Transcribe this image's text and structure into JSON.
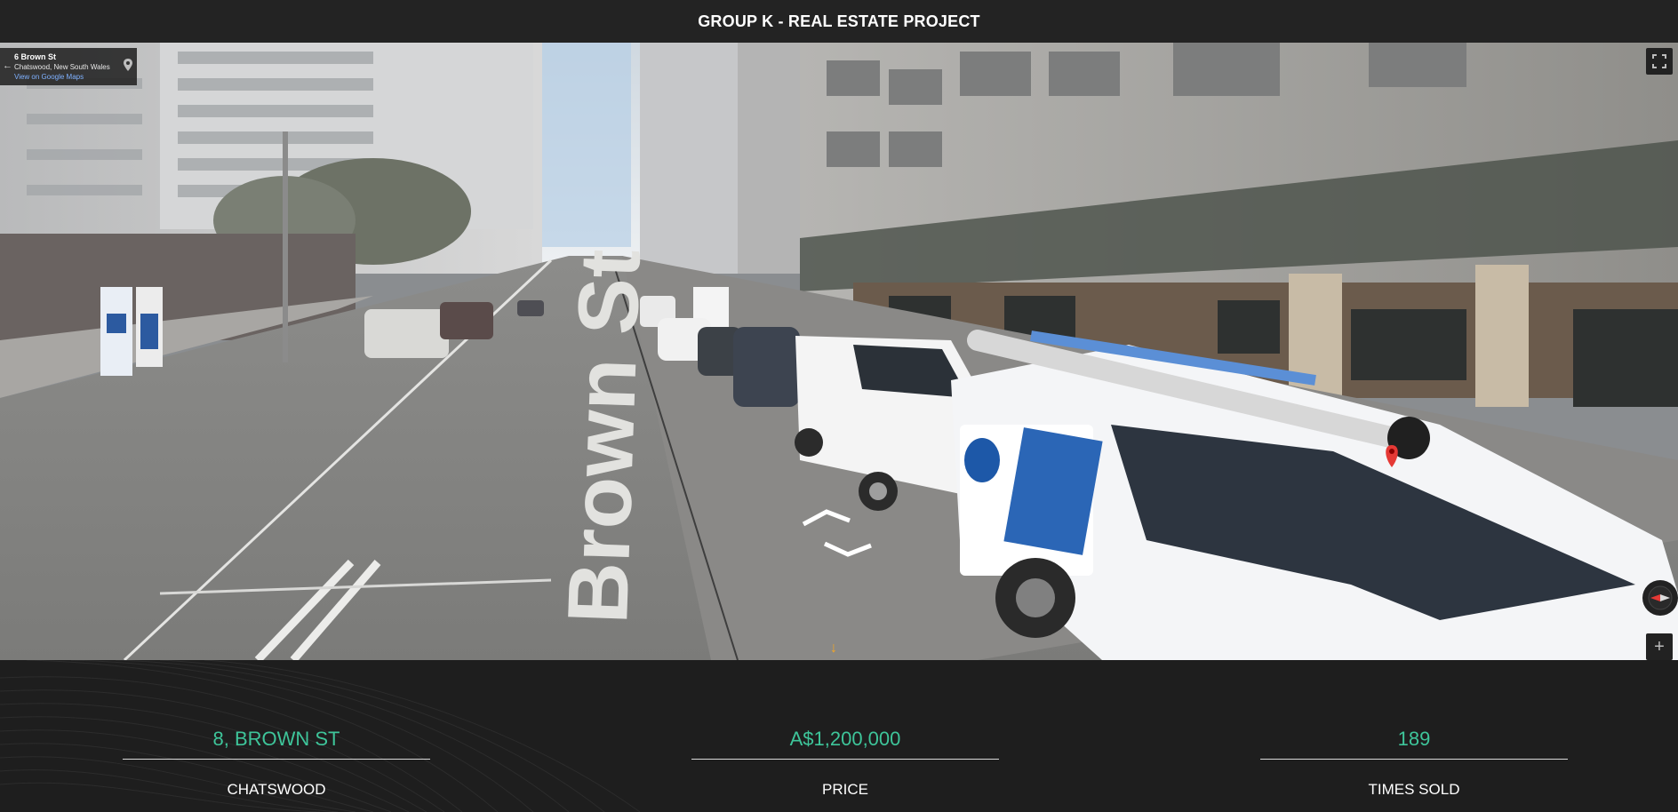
{
  "header": {
    "title": "GROUP K - REAL ESTATE PROJECT"
  },
  "street_view": {
    "address": "6 Brown St",
    "locality": "Chatswood, New South Wales",
    "map_link": "View on Google Maps",
    "road_marking": "Brown St",
    "icons": [
      "back-arrow-icon",
      "map-pin-icon",
      "fullscreen-icon",
      "compass-icon",
      "zoom-in-icon",
      "navigate-forward-icon",
      "navigate-back-icon",
      "scroll-down-icon"
    ],
    "zoom_label": "+"
  },
  "stats": [
    {
      "value": "8, BROWN ST",
      "label": "CHATSWOOD"
    },
    {
      "value": "A$1,200,000",
      "label": "PRICE"
    },
    {
      "value": "189",
      "label": "TIMES SOLD"
    }
  ],
  "colors": {
    "accent": "#3ec59a",
    "background": "#1f1f1f",
    "header": "#232323"
  }
}
